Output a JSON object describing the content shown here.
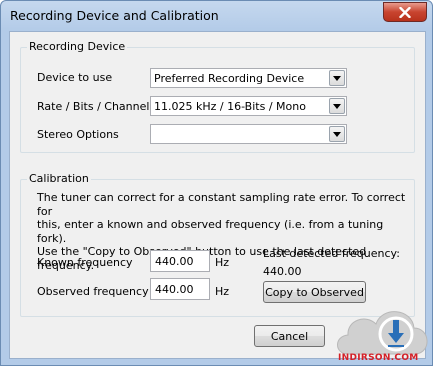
{
  "window": {
    "title": "Recording Device and Calibration",
    "close_icon": "close-x-icon"
  },
  "recording_device": {
    "legend": "Recording Device",
    "device_label": "Device to use",
    "device_value": "Preferred Recording Device",
    "rate_label": "Rate / Bits / Channel",
    "rate_value": "11.025 kHz / 16-Bits / Mono",
    "stereo_label": "Stereo Options",
    "stereo_value": ""
  },
  "calibration": {
    "legend": "Calibration",
    "description_lines": [
      "The tuner can correct for a constant sampling rate error.  To correct for",
      "this, enter a known and observed frequency (i.e. from a tuning fork).",
      "Use the \"Copy to Observed\" button to use the last detected frequency."
    ],
    "known_label": "Known frequency",
    "known_value": "440.00",
    "known_unit": "Hz",
    "observed_label": "Observed frequency",
    "observed_value": "440.00",
    "observed_unit": "Hz",
    "last_detected_label": "Last detected frequency:",
    "last_detected_value": "440.00",
    "copy_button": "Copy to Observed"
  },
  "footer": {
    "cancel_button": "Cancel"
  },
  "watermark": {
    "text": "INDIRSON.COM",
    "icon": "cloud-download-icon",
    "colors": {
      "red": "#d42027",
      "blue": "#2a6fb8",
      "cloud": "#c8c8c8"
    }
  }
}
